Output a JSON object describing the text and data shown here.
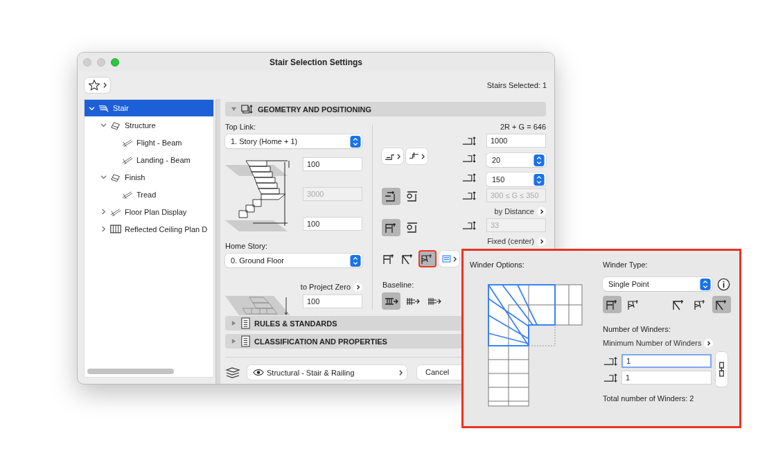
{
  "window": {
    "title": "Stair Selection Settings",
    "selection_count": "Stairs Selected: 1"
  },
  "tree": [
    {
      "label": "Stair",
      "selected": true,
      "expanded": true,
      "children": [
        {
          "label": "Structure",
          "selected": false,
          "expanded": true,
          "children": [
            {
              "label": "Flight - Beam",
              "selected": false
            },
            {
              "label": "Landing - Beam",
              "selected": false
            }
          ]
        },
        {
          "label": "Finish",
          "selected": false,
          "expanded": true,
          "children": [
            {
              "label": "Tread",
              "selected": false
            }
          ]
        },
        {
          "label": "Floor Plan Display",
          "selected": false,
          "expanded": false
        },
        {
          "label": "Reflected Ceiling Plan D",
          "selected": false,
          "expanded": false
        }
      ]
    }
  ],
  "geometry": {
    "title": "GEOMETRY AND POSITIONING",
    "expanded": true,
    "top_link": {
      "label": "Top Link:",
      "value": "1. Story (Home + 1)"
    },
    "top_offset": {
      "value": "100",
      "disabled": false
    },
    "height": {
      "value": "3000",
      "disabled": true
    },
    "bottom_offset": {
      "value": "100",
      "disabled": false
    },
    "home_story": {
      "label": "Home Story:",
      "value": "0. Ground Floor"
    },
    "project_zero": {
      "label": "to Project Zero",
      "value": "100"
    },
    "formula": "2R + G = 646",
    "flight_width": {
      "value": "1000",
      "disabled": false
    },
    "riser_count": {
      "value": "20"
    },
    "riser_height": {
      "value": "150"
    },
    "tread_depth": {
      "value": "300 ≤ G ≤ 350",
      "disabled": true
    },
    "tread_method": "by Distance",
    "tread_number": {
      "value": "33",
      "disabled": true
    },
    "walking_line": "Fixed (center)",
    "lock_options": [
      {
        "selected": true
      },
      {
        "selected": false
      }
    ],
    "tread_options": [
      {
        "selected": true
      },
      {
        "selected": false
      }
    ],
    "shape_options": [
      {
        "selected": false,
        "highlighted": false
      },
      {
        "selected": false,
        "highlighted": false
      },
      {
        "selected": true,
        "highlighted": true
      }
    ],
    "baseline": {
      "label": "Baseline:",
      "options": [
        {
          "selected": true
        },
        {
          "selected": false
        },
        {
          "selected": false
        }
      ]
    }
  },
  "sections": [
    {
      "title": "RULES & STANDARDS",
      "expanded": false
    },
    {
      "title": "CLASSIFICATION AND PROPERTIES",
      "expanded": false
    }
  ],
  "footer": {
    "layer": "Structural - Stair & Railing",
    "cancel": "Cancel"
  },
  "winder_panel": {
    "title": "Winder Options:",
    "type_label": "Winder Type:",
    "type": "Single Point",
    "corner_options": [
      {
        "selected": true
      },
      {
        "selected": false
      }
    ],
    "distribution_options": [
      {
        "selected": false
      },
      {
        "selected": false
      },
      {
        "selected": true
      }
    ],
    "count_label": "Number of Winders:",
    "count_method": "Minimum Number of Winders",
    "first_count": {
      "value": "1",
      "focused": true
    },
    "second_count": {
      "value": "1",
      "focused": false
    },
    "total": "Total number of Winders: 2"
  }
}
